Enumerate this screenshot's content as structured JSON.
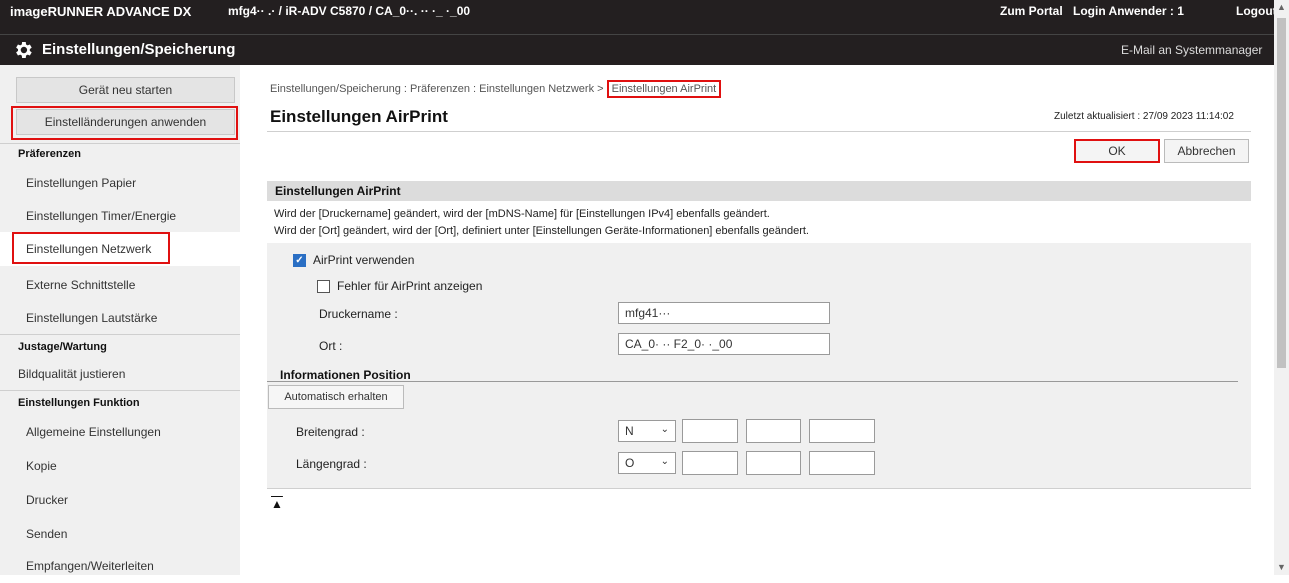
{
  "topbar": {
    "brand": "imageRUNNER ADVANCE DX",
    "device": "mfg4·· .· / iR-ADV C5870 / CA_0··. ·· ·_ ·_00",
    "portal": "Zum Portal",
    "login": "Login Anwender :  1",
    "logout": "Logout"
  },
  "titlebar": {
    "title": "Einstellungen/Speicherung",
    "mail": "E-Mail an Systemmanager",
    "icon": "gear-icon"
  },
  "sidebar": {
    "restart_label": "Gerät neu starten",
    "apply_label": "Einstelländerungen anwenden",
    "groups": [
      {
        "heading": "Präferenzen",
        "items": [
          "Einstellungen Papier",
          "Einstellungen Timer/Energie",
          "Einstellungen Netzwerk",
          "Externe Schnittstelle",
          "Einstellungen Lautstärke"
        ]
      },
      {
        "heading": "Justage/Wartung",
        "items": [
          "Bildqualität justieren"
        ]
      },
      {
        "heading": "Einstellungen Funktion",
        "items": [
          "Allgemeine Einstellungen",
          "Kopie",
          "Drucker",
          "Senden",
          "Empfangen/Weiterleiten"
        ]
      }
    ]
  },
  "main": {
    "breadcrumb_path": "Einstellungen/Speicherung : Präferenzen : Einstellungen Netzwerk > ",
    "breadcrumb_current": "Einstellungen AirPrint",
    "title": "Einstellungen AirPrint",
    "updated": "Zuletzt aktualisiert : 27/09 2023 11:14:02",
    "ok_label": "OK",
    "cancel_label": "Abbrechen",
    "section_title": "Einstellungen AirPrint",
    "desc_line1": "Wird der [Druckername] geändert, wird der [mDNS-Name] für [Einstellungen IPv4] ebenfalls geändert.",
    "desc_line2": "Wird der [Ort] geändert, wird der [Ort], definiert unter [Einstellungen Geräte-Informationen] ebenfalls geändert.",
    "airprint_label": "AirPrint verwenden",
    "airprint_checked": true,
    "errors_label": "Fehler für AirPrint anzeigen",
    "errors_checked": false,
    "printer_name_label": "Druckername :",
    "printer_name_value": "mfg41···",
    "location_label": "Ort :",
    "location_value": "CA_0· ·· F2_0· ·_00",
    "position_heading": "Informationen Position",
    "auto_label": "Automatisch erhalten",
    "latitude_label": "Breitengrad :",
    "latitude_dir": "N",
    "longitude_label": "Längengrad :",
    "longitude_dir": "O",
    "top_icon": "▲"
  }
}
